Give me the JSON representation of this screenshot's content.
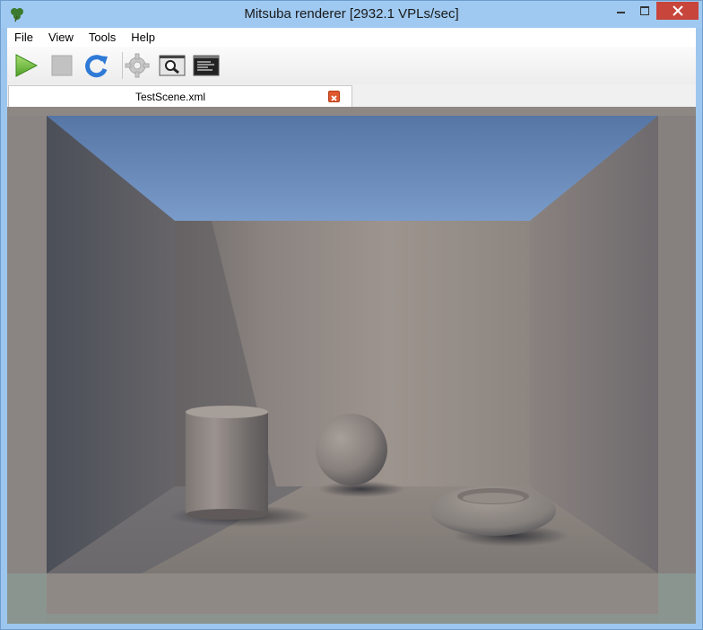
{
  "window": {
    "title": "Mitsuba renderer [2932.1 VPLs/sec]",
    "icon": "clover-icon"
  },
  "menu": {
    "items": [
      "File",
      "View",
      "Tools",
      "Help"
    ]
  },
  "toolbar": {
    "buttons": [
      {
        "name": "start-render",
        "icon": "play-icon"
      },
      {
        "name": "stop-render",
        "icon": "stop-icon"
      },
      {
        "name": "refresh",
        "icon": "refresh-icon"
      },
      {
        "name": "settings",
        "icon": "gear-icon"
      },
      {
        "name": "inspect",
        "icon": "magnifier-icon"
      },
      {
        "name": "log",
        "icon": "console-icon"
      }
    ]
  },
  "tabs": [
    {
      "label": "TestScene.xml",
      "active": true
    }
  ],
  "colors": {
    "titlebar": "#9fc9f0",
    "close_button": "#c7453b",
    "play_green": "#7cc64a",
    "refresh_blue": "#2e7ad6",
    "tab_close": "#e0582e",
    "sky": "#5b7faf"
  }
}
